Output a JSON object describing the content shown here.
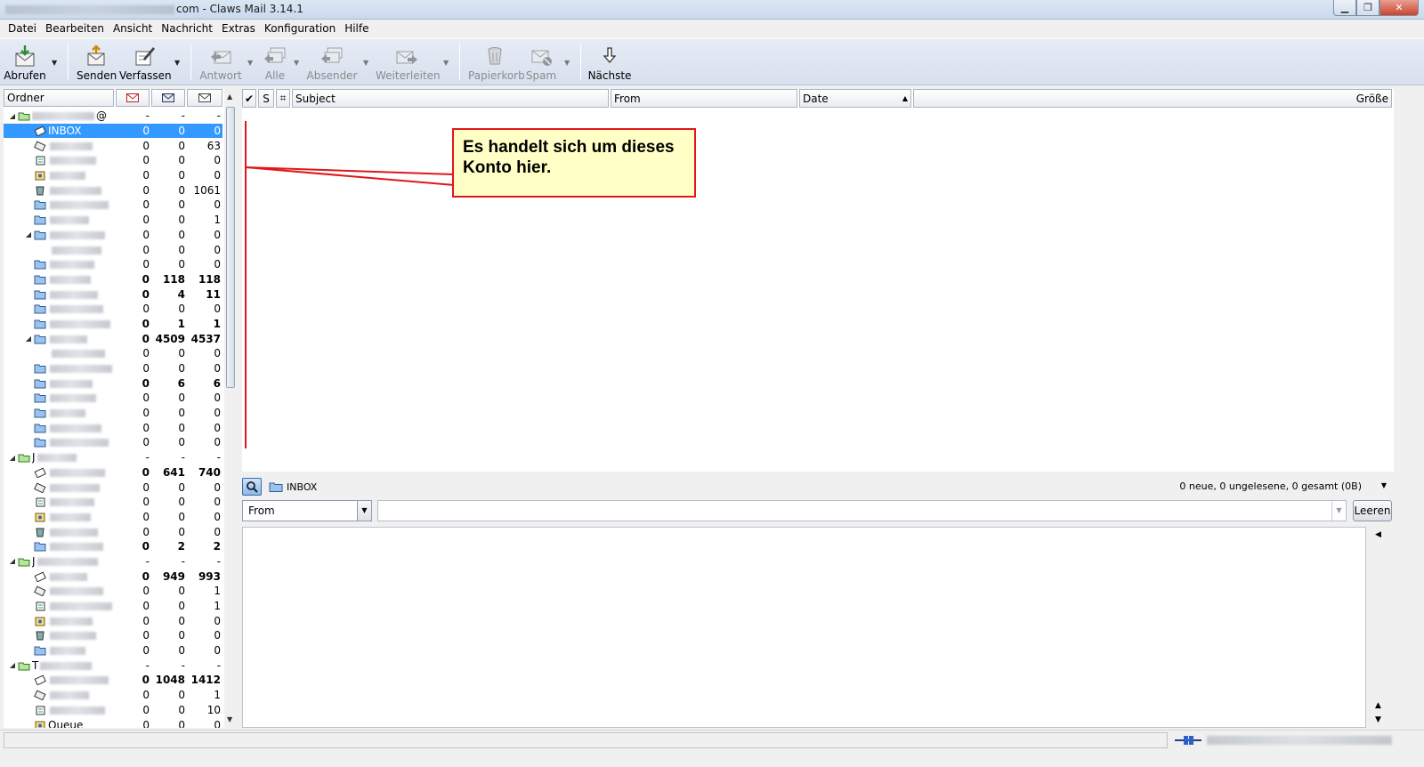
{
  "window": {
    "title_suffix": "com - Claws Mail 3.14.1",
    "buttons": {
      "minimize": "▁",
      "restore": "❐",
      "close": "✕"
    }
  },
  "menu": [
    "Datei",
    "Bearbeiten",
    "Ansicht",
    "Nachricht",
    "Extras",
    "Konfiguration",
    "Hilfe"
  ],
  "toolbar": {
    "abrufen": "Abrufen",
    "senden": "Senden",
    "verfassen": "Verfassen",
    "antwort": "Antwort",
    "alle": "Alle",
    "absender": "Absender",
    "weiterleiten": "Weiterleiten",
    "papierkorb": "Papierkorb",
    "spam": "Spam",
    "naechste": "Nächste"
  },
  "folder_header": {
    "ordner": "Ordner"
  },
  "folders": [
    {
      "name": "@",
      "c1": "-",
      "c2": "-",
      "c3": "-",
      "type": "account",
      "tw": "◢"
    },
    {
      "name": "INBOX",
      "c1": "0",
      "c2": "0",
      "c3": "0",
      "type": "inbox",
      "selected": true
    },
    {
      "name": "",
      "c1": "0",
      "c2": "0",
      "c3": "63",
      "type": "outbox"
    },
    {
      "name": "",
      "c1": "0",
      "c2": "0",
      "c3": "0",
      "type": "draft"
    },
    {
      "name": "",
      "c1": "0",
      "c2": "0",
      "c3": "0",
      "type": "queue"
    },
    {
      "name": "",
      "c1": "0",
      "c2": "0",
      "c3": "1061",
      "type": "trash"
    },
    {
      "name": "",
      "c1": "0",
      "c2": "0",
      "c3": "0",
      "type": "folder"
    },
    {
      "name": "",
      "c1": "0",
      "c2": "0",
      "c3": "1",
      "type": "folder"
    },
    {
      "name": "",
      "c1": "0",
      "c2": "0",
      "c3": "0",
      "type": "folder",
      "tw": "◢"
    },
    {
      "name": "",
      "c1": "0",
      "c2": "0",
      "c3": "0",
      "type": "none"
    },
    {
      "name": "",
      "c1": "0",
      "c2": "0",
      "c3": "0",
      "type": "folder"
    },
    {
      "name": "",
      "c1": "0",
      "c2": "118",
      "c3": "118",
      "type": "folder",
      "bold": true
    },
    {
      "name": "",
      "c1": "0",
      "c2": "4",
      "c3": "11",
      "type": "folder",
      "bold": true
    },
    {
      "name": "",
      "c1": "0",
      "c2": "0",
      "c3": "0",
      "type": "folder"
    },
    {
      "name": "",
      "c1": "0",
      "c2": "1",
      "c3": "1",
      "type": "folder",
      "bold": true
    },
    {
      "name": "",
      "c1": "0",
      "c2": "4509",
      "c3": "4537",
      "type": "folder",
      "bold": true,
      "tw": "◢"
    },
    {
      "name": "",
      "c1": "0",
      "c2": "0",
      "c3": "0",
      "type": "none"
    },
    {
      "name": "",
      "c1": "0",
      "c2": "0",
      "c3": "0",
      "type": "folder"
    },
    {
      "name": "",
      "c1": "0",
      "c2": "6",
      "c3": "6",
      "type": "folder",
      "bold": true
    },
    {
      "name": "",
      "c1": "0",
      "c2": "0",
      "c3": "0",
      "type": "folder"
    },
    {
      "name": "",
      "c1": "0",
      "c2": "0",
      "c3": "0",
      "type": "folder"
    },
    {
      "name": "",
      "c1": "0",
      "c2": "0",
      "c3": "0",
      "type": "folder"
    },
    {
      "name": "",
      "c1": "0",
      "c2": "0",
      "c3": "0",
      "type": "folder"
    },
    {
      "name": "J",
      "c1": "-",
      "c2": "-",
      "c3": "-",
      "type": "account",
      "tw": "◢"
    },
    {
      "name": "",
      "c1": "0",
      "c2": "641",
      "c3": "740",
      "type": "inbox",
      "bold": true
    },
    {
      "name": "",
      "c1": "0",
      "c2": "0",
      "c3": "0",
      "type": "outbox"
    },
    {
      "name": "",
      "c1": "0",
      "c2": "0",
      "c3": "0",
      "type": "draft"
    },
    {
      "name": "",
      "c1": "0",
      "c2": "0",
      "c3": "0",
      "type": "queue"
    },
    {
      "name": "",
      "c1": "0",
      "c2": "0",
      "c3": "0",
      "type": "trash"
    },
    {
      "name": "",
      "c1": "0",
      "c2": "2",
      "c3": "2",
      "type": "folder",
      "bold": true
    },
    {
      "name": "J",
      "c1": "-",
      "c2": "-",
      "c3": "-",
      "type": "account",
      "tw": "◢"
    },
    {
      "name": "",
      "c1": "0",
      "c2": "949",
      "c3": "993",
      "type": "inbox",
      "bold": true
    },
    {
      "name": "",
      "c1": "0",
      "c2": "0",
      "c3": "1",
      "type": "outbox"
    },
    {
      "name": "",
      "c1": "0",
      "c2": "0",
      "c3": "1",
      "type": "draft"
    },
    {
      "name": "",
      "c1": "0",
      "c2": "0",
      "c3": "0",
      "type": "queue"
    },
    {
      "name": "",
      "c1": "0",
      "c2": "0",
      "c3": "0",
      "type": "trash"
    },
    {
      "name": "",
      "c1": "0",
      "c2": "0",
      "c3": "0",
      "type": "folder"
    },
    {
      "name": "T",
      "c1": "-",
      "c2": "-",
      "c3": "-",
      "type": "account",
      "tw": "◢"
    },
    {
      "name": "",
      "c1": "0",
      "c2": "1048",
      "c3": "1412",
      "type": "inbox",
      "bold": true
    },
    {
      "name": "",
      "c1": "0",
      "c2": "0",
      "c3": "1",
      "type": "outbox"
    },
    {
      "name": "",
      "c1": "0",
      "c2": "0",
      "c3": "10",
      "type": "draft"
    },
    {
      "name": "Queue",
      "c1": "0",
      "c2": "0",
      "c3": "0",
      "type": "queue"
    }
  ],
  "msg_header": {
    "check": "✔",
    "s": "S",
    "subject": "Subject",
    "from": "From",
    "date": "Date",
    "size": "Größe"
  },
  "callout": {
    "line1": "Es handelt sich um dieses",
    "line2": "Konto hier."
  },
  "quicksearch": {
    "folder": "INBOX",
    "status": "0 neue, 0 ungelesene, 0 gesamt (0B)",
    "filter_type": "From",
    "filter_value": "",
    "clear": "Leeren"
  },
  "colors": {
    "selection": "#3399ff",
    "callout_border": "#e0161a",
    "callout_bg": "#ffffc6"
  }
}
